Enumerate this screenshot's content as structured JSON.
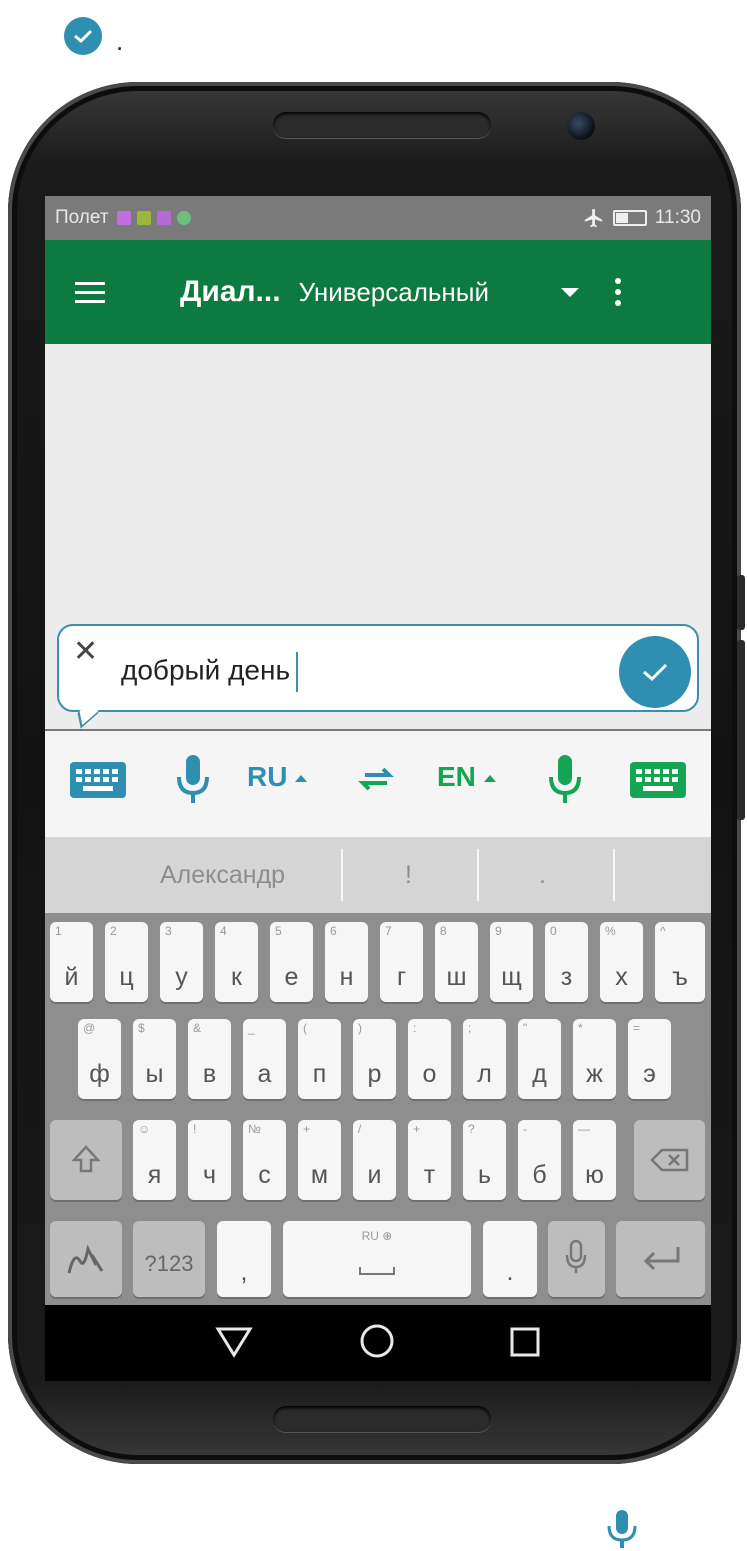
{
  "top": {
    "dot": "."
  },
  "status": {
    "text": "Полет",
    "time": "11:30",
    "notif_colors": [
      "#c06ee0",
      "#9cb83c",
      "#b66ad8",
      "#6bbf7a"
    ]
  },
  "appbar": {
    "title": "Диал...",
    "mode": "Универсальный"
  },
  "input": {
    "text": "добрый день"
  },
  "lang_bar": {
    "source_lang": "RU",
    "target_lang": "EN",
    "source_color": "#2e8fb0",
    "target_color": "#13a552"
  },
  "suggestions": [
    "Александр",
    "!",
    "."
  ],
  "keyboard": {
    "row1": [
      {
        "h": "1",
        "k": "й"
      },
      {
        "h": "2",
        "k": "ц"
      },
      {
        "h": "3",
        "k": "у"
      },
      {
        "h": "4",
        "k": "к"
      },
      {
        "h": "5",
        "k": "е"
      },
      {
        "h": "6",
        "k": "н"
      },
      {
        "h": "7",
        "k": "г"
      },
      {
        "h": "8",
        "k": "ш"
      },
      {
        "h": "9",
        "k": "щ"
      },
      {
        "h": "0",
        "k": "з"
      },
      {
        "h": "%",
        "k": "х"
      },
      {
        "h": "^",
        "k": "ъ"
      }
    ],
    "row2": [
      {
        "h": "@",
        "k": "ф"
      },
      {
        "h": "$",
        "k": "ы"
      },
      {
        "h": "&",
        "k": "в"
      },
      {
        "h": "_",
        "k": "а"
      },
      {
        "h": "(",
        "k": "п"
      },
      {
        "h": ")",
        "k": "р"
      },
      {
        "h": ":",
        "k": "о"
      },
      {
        "h": ";",
        "k": "л"
      },
      {
        "h": "\"",
        "k": "д"
      },
      {
        "h": "*",
        "k": "ж"
      },
      {
        "h": "=",
        "k": "э"
      }
    ],
    "row3": [
      {
        "h": "☺",
        "k": "я"
      },
      {
        "h": "!",
        "k": "ч"
      },
      {
        "h": "№",
        "k": "с"
      },
      {
        "h": "+",
        "k": "м"
      },
      {
        "h": "/",
        "k": "и"
      },
      {
        "h": "+",
        "k": "т"
      },
      {
        "h": "?",
        "k": "ь"
      },
      {
        "h": "-",
        "k": "б"
      },
      {
        "h": "—",
        "k": "ю"
      }
    ],
    "symbols": "?123",
    "comma": ",",
    "period": ".",
    "space_hint": "RU ⊕"
  }
}
